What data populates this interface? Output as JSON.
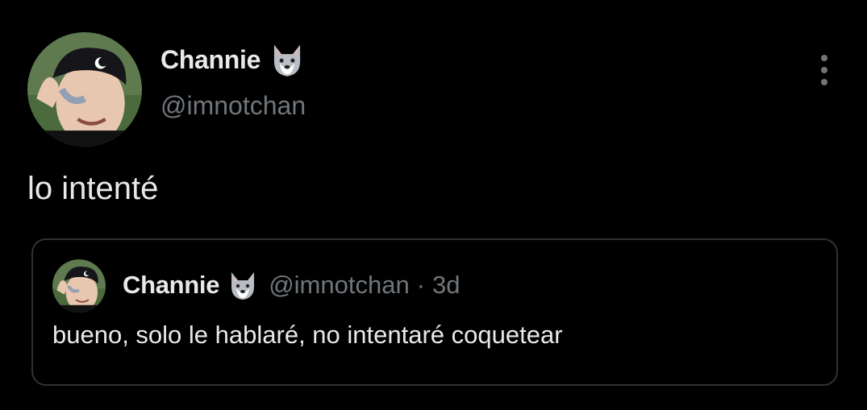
{
  "tweet": {
    "author": {
      "display_name": "Channie",
      "name_emoji": "wolf-face-icon",
      "handle": "@imnotchan"
    },
    "text": "lo intenté",
    "menu_icon": "more-vertical-icon"
  },
  "quoted_tweet": {
    "author": {
      "display_name": "Channie",
      "name_emoji": "wolf-face-icon",
      "handle": "@imnotchan"
    },
    "separator": "·",
    "time": "3d",
    "text": "bueno, solo le hablaré, no intentaré coquetear"
  },
  "colors": {
    "background": "#000000",
    "primary_text": "#e7e9ea",
    "secondary_text": "#71767b",
    "border": "#2f3336"
  }
}
